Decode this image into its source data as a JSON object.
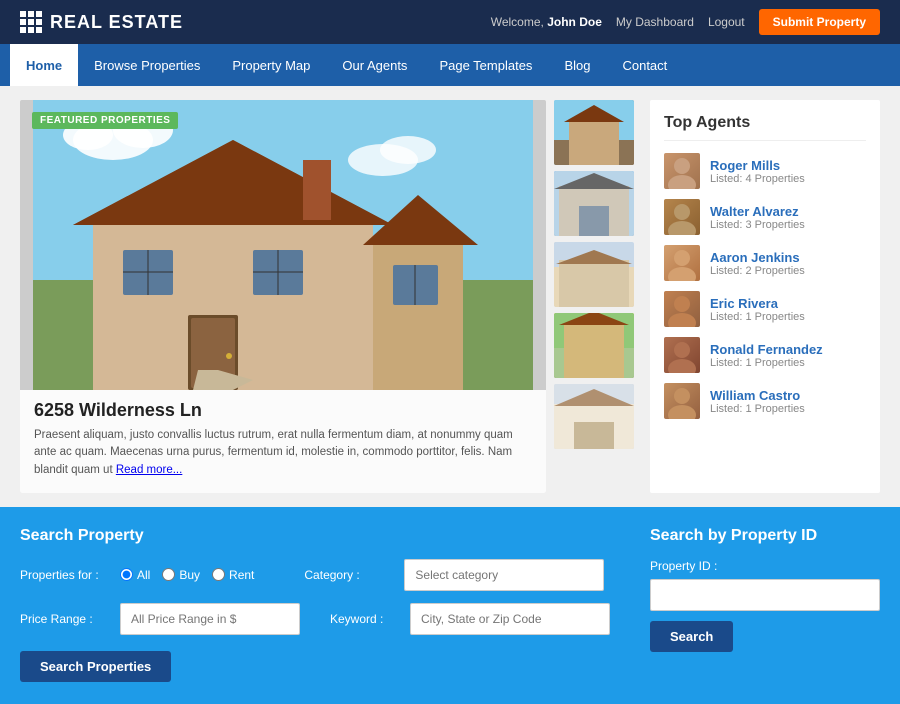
{
  "header": {
    "logo_text": "REAL ESTATE",
    "welcome_text": "Welcome,",
    "user_name": "John Doe",
    "dashboard_link": "My Dashboard",
    "logout_link": "Logout",
    "submit_btn": "Submit Property"
  },
  "nav": {
    "items": [
      {
        "label": "Home",
        "active": true
      },
      {
        "label": "Browse Properties",
        "active": false
      },
      {
        "label": "Property Map",
        "active": false
      },
      {
        "label": "Our Agents",
        "active": false
      },
      {
        "label": "Page Templates",
        "active": false
      },
      {
        "label": "Blog",
        "active": false
      },
      {
        "label": "Contact",
        "active": false
      }
    ]
  },
  "featured": {
    "badge": "FEATURED PROPERTIES",
    "title": "6258 Wilderness Ln",
    "description": "Praesent aliquam, justo convallis luctus rutrum, erat nulla fermentum diam, at nonummy quam ante ac quam. Maecenas urna purus, fermentum id, molestie in, commodo porttitor, felis. Nam blandit quam ut",
    "read_more": "Read more..."
  },
  "agents": {
    "section_title": "Top Agents",
    "list": [
      {
        "name": "Roger Mills",
        "listed": "Listed: 4 Properties"
      },
      {
        "name": "Walter Alvarez",
        "listed": "Listed: 3 Properties"
      },
      {
        "name": "Aaron Jenkins",
        "listed": "Listed: 2 Properties"
      },
      {
        "name": "Eric Rivera",
        "listed": "Listed: 1 Properties"
      },
      {
        "name": "Ronald Fernandez",
        "listed": "Listed: 1 Properties"
      },
      {
        "name": "William Castro",
        "listed": "Listed: 1 Properties"
      }
    ]
  },
  "search_property": {
    "title": "Search Property",
    "properties_for_label": "Properties for :",
    "radio_all": "All",
    "radio_buy": "Buy",
    "radio_rent": "Rent",
    "category_label": "Category :",
    "category_placeholder": "Select category",
    "price_range_label": "Price Range :",
    "price_range_placeholder": "All Price Range in $",
    "keyword_label": "Keyword :",
    "keyword_placeholder": "City, State or Zip Code",
    "search_btn": "Search Properties"
  },
  "search_by_id": {
    "title": "Search by Property ID",
    "property_id_label": "Property ID :",
    "property_id_placeholder": "",
    "search_btn": "Search"
  }
}
